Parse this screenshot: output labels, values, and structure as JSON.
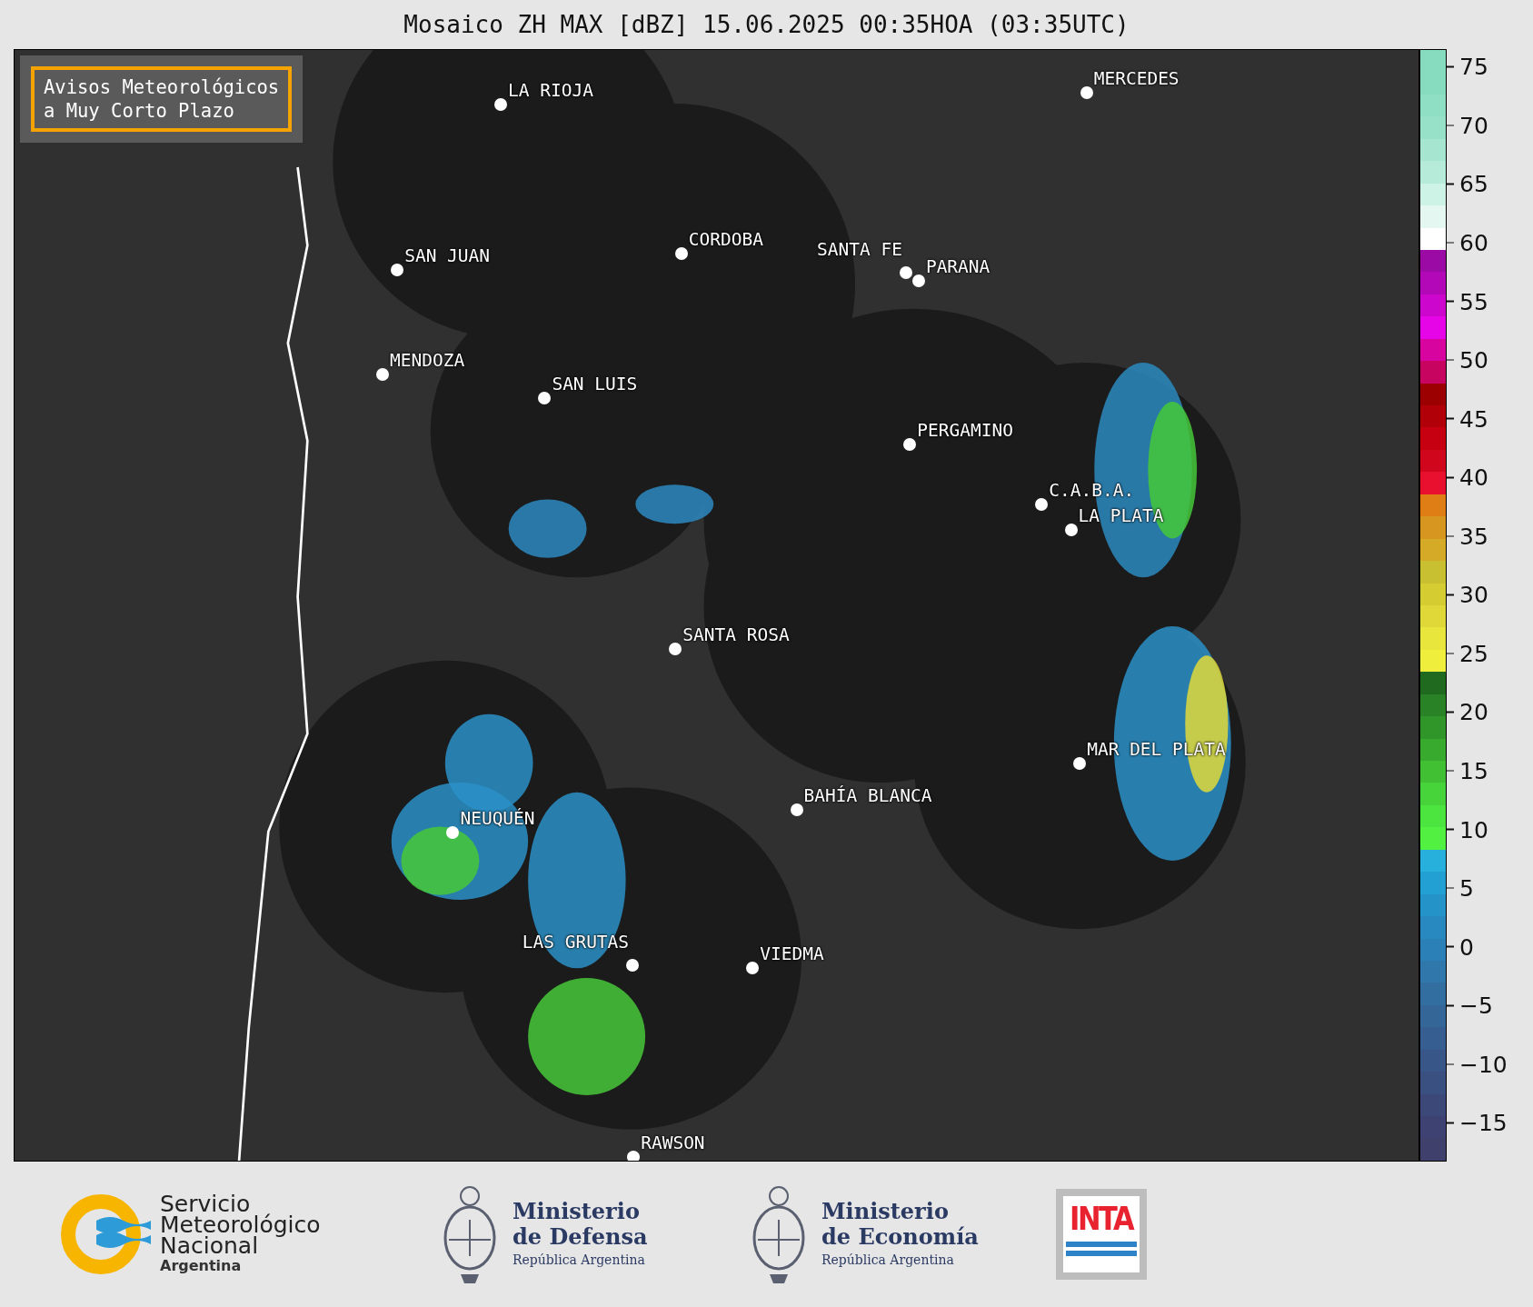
{
  "title": "Mosaico ZH MAX [dBZ] 15.06.2025 00:35HOA (03:35UTC)",
  "notice": {
    "lines": [
      "Avisos Meteorológicos",
      "a Muy Corto Plazo"
    ]
  },
  "cities": [
    {
      "name": "LA RIOJA"
    },
    {
      "name": "CORDOBA"
    },
    {
      "name": "SAN JUAN"
    },
    {
      "name": "SANTA FE"
    },
    {
      "name": "PARANA"
    },
    {
      "name": "MENDOZA"
    },
    {
      "name": "SAN LUIS"
    },
    {
      "name": "MERCEDES"
    },
    {
      "name": "PERGAMINO"
    },
    {
      "name": "C.A.B.A."
    },
    {
      "name": "LA PLATA"
    },
    {
      "name": "SANTA ROSA"
    },
    {
      "name": "MAR DEL PLATA"
    },
    {
      "name": "BAHÍA BLANCA"
    },
    {
      "name": "NEUQUÉN"
    },
    {
      "name": "LAS GRUTAS"
    },
    {
      "name": "VIEDMA"
    },
    {
      "name": "RAWSON"
    }
  ],
  "colorbar": {
    "ticks": [
      "75",
      "70",
      "65",
      "60",
      "55",
      "50",
      "45",
      "40",
      "35",
      "30",
      "25",
      "20",
      "15",
      "10",
      "5",
      "0",
      "−5",
      "−10",
      "−15"
    ]
  },
  "footer": {
    "smn": {
      "lines": [
        "Servicio",
        "Meteorológico",
        "Nacional"
      ],
      "country": "Argentina"
    },
    "ministries": [
      {
        "title": "Ministerio",
        "department": "de Defensa",
        "country": "República Argentina"
      },
      {
        "title": "Ministerio",
        "department": "de Economía",
        "country": "República Argentina"
      }
    ],
    "inta": "INTA"
  }
}
